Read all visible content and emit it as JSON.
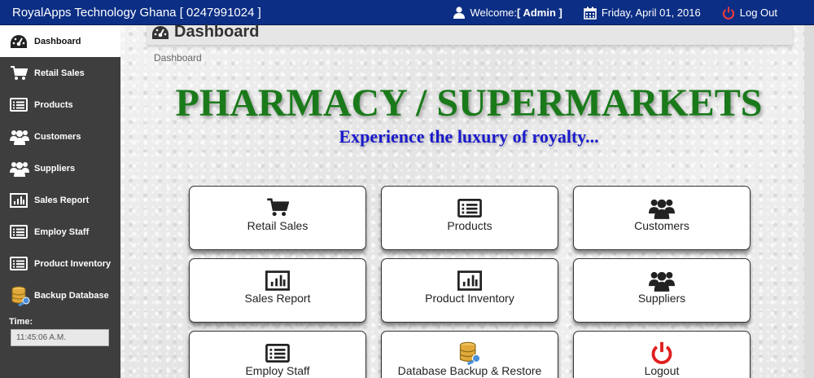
{
  "topbar": {
    "brand": "RoyalApps Technology Ghana [ 0247991024 ]",
    "welcome_prefix": "Welcome:",
    "welcome_user": "[ Admin ]",
    "date": "Friday, April 01, 2016",
    "logout": "Log Out"
  },
  "sidebar": {
    "items": [
      {
        "label": "Dashboard",
        "icon": "dashboard-icon",
        "active": true
      },
      {
        "label": "Retail Sales",
        "icon": "cart-icon"
      },
      {
        "label": "Products",
        "icon": "list-icon"
      },
      {
        "label": "Customers",
        "icon": "users-icon"
      },
      {
        "label": "Suppliers",
        "icon": "users-icon"
      },
      {
        "label": "Sales Report",
        "icon": "bar-chart-icon"
      },
      {
        "label": "Employ Staff",
        "icon": "list-icon"
      },
      {
        "label": "Product Inventory",
        "icon": "list-icon"
      },
      {
        "label": "Backup Database",
        "icon": "database-icon"
      }
    ],
    "time_label": "Time:",
    "time_value": "11:45:06 A.M."
  },
  "main": {
    "page_title": "Dashboard",
    "breadcrumb": "Dashboard",
    "hero_title": "PHARMACY / SUPERMARKETS",
    "hero_subtitle": "Experience the luxury of royalty...",
    "tiles": [
      {
        "label": "Retail Sales",
        "icon": "cart-icon"
      },
      {
        "label": "Products",
        "icon": "list-icon"
      },
      {
        "label": "Customers",
        "icon": "users-icon"
      },
      {
        "label": "Sales Report",
        "icon": "bar-chart-icon"
      },
      {
        "label": "Product Inventory",
        "icon": "bar-chart-icon"
      },
      {
        "label": "Suppliers",
        "icon": "users-icon"
      },
      {
        "label": "Employ Staff",
        "icon": "list-icon"
      },
      {
        "label": "Database Backup & Restore",
        "icon": "database-icon"
      },
      {
        "label": "Logout",
        "icon": "power-icon"
      }
    ]
  },
  "colors": {
    "topbar": "#0c2e84",
    "sidebar": "#3e3e3e",
    "hero_title": "#1a7a1a",
    "hero_subtitle": "#1a1acc",
    "logout_icon": "#e02020"
  }
}
